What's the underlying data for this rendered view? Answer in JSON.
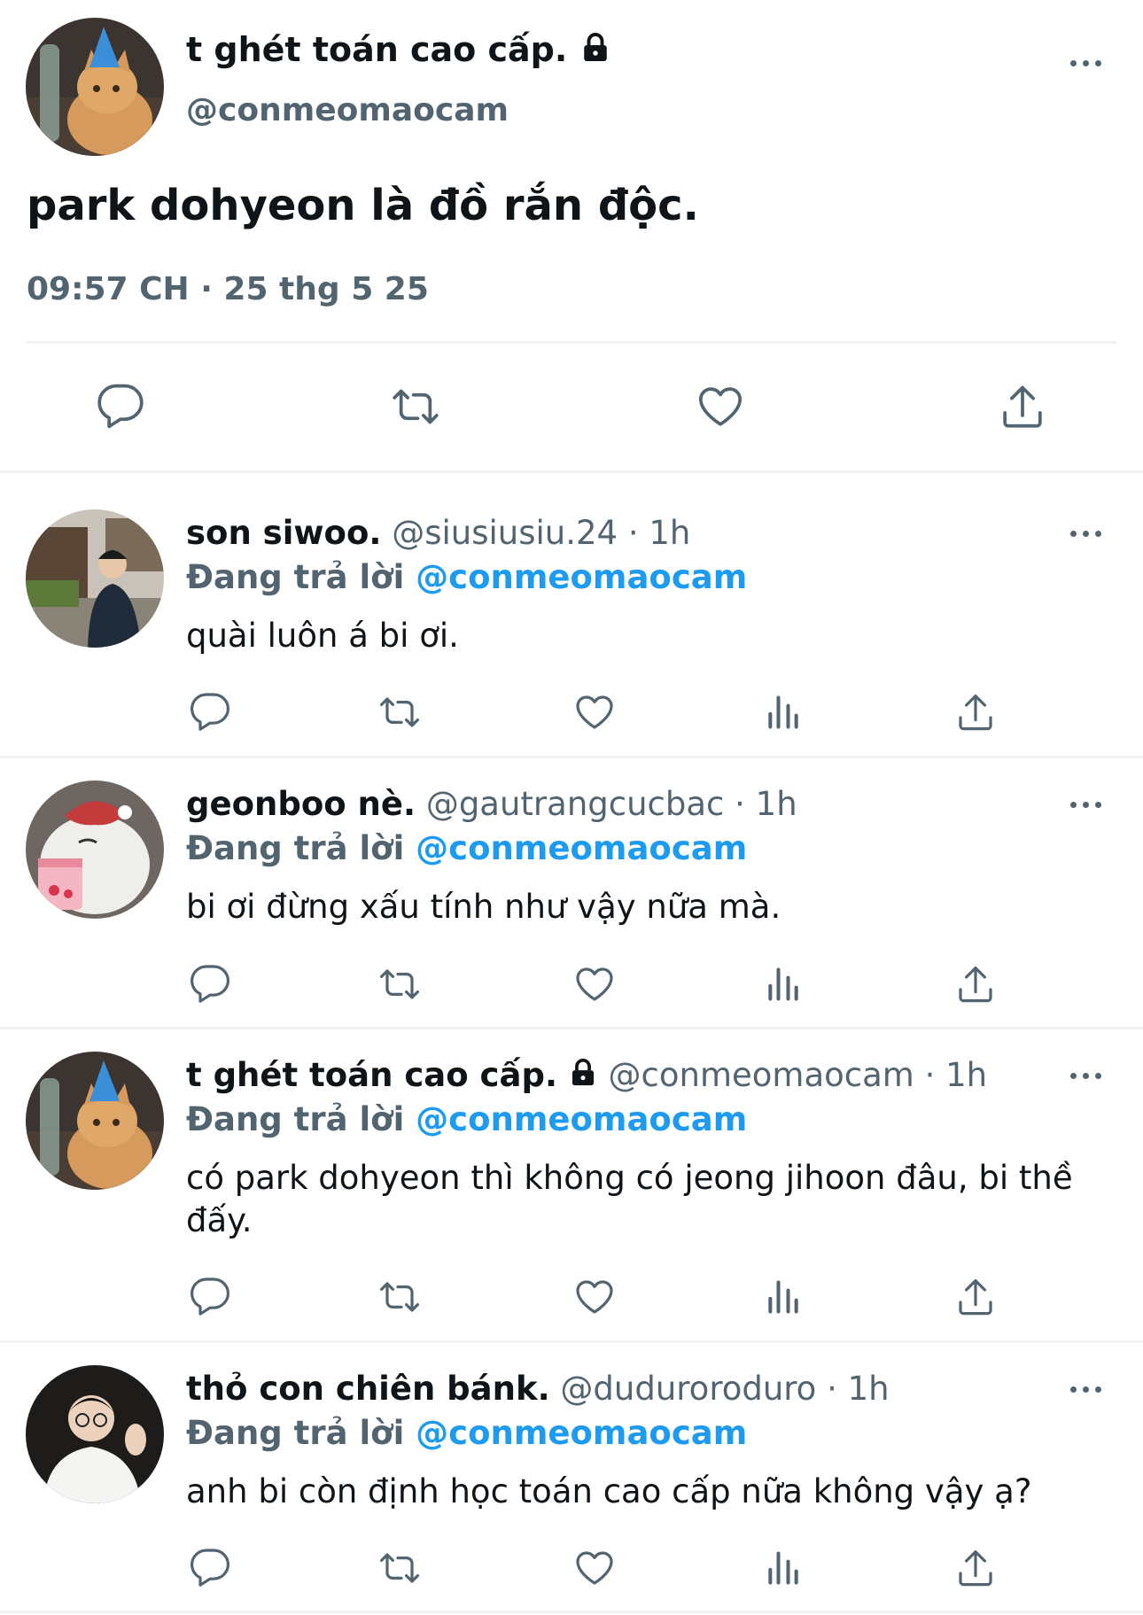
{
  "main_tweet": {
    "display_name": "t ghét toán cao cấp.",
    "handle": "@conmeomaocam",
    "text": "park dohyeon là đồ rắn độc.",
    "timestamp": "09:57 CH · 25 thg 5 25",
    "avatar": "orange-cat-with-party-hat"
  },
  "replies": [
    {
      "display_name": "son siwoo.",
      "handle": "@siusiusiu.24",
      "time": "· 1h",
      "replying_prefix": "Đang trả lời",
      "replying_to": "@conmeomaocam",
      "text": [
        "quài luôn á bi ơi."
      ],
      "avatar": "person-in-street",
      "locked": false
    },
    {
      "display_name": "geonboo nè.",
      "handle": "@gautrangcucbac",
      "time": "· 1h",
      "replying_prefix": "Đang trả lời",
      "replying_to": "@conmeomaocam",
      "text": [
        "bi ơi đừng xấu tính như vậy nữa mà."
      ],
      "avatar": "bear-with-strawberry-cup",
      "locked": false
    },
    {
      "display_name": "t ghét toán cao cấp.",
      "handle": "@conmeomaocam",
      "time": "· 1h",
      "replying_prefix": "Đang trả lời",
      "replying_to": "@conmeomaocam",
      "text": [
        "có park dohyeon thì không có jeong jihoon đâu, bi thề",
        "đấy."
      ],
      "avatar": "orange-cat-with-party-hat",
      "locked": true
    },
    {
      "display_name": "thỏ con chiên bánk.",
      "handle": "@duduroroduro",
      "time": "· 1h",
      "replying_prefix": "Đang trả lời",
      "replying_to": "@conmeomaocam",
      "text": [
        "anh bi còn định học toán cao cấp nữa không vậy ạ?"
      ],
      "avatar": "person-white-shirt-waving",
      "locked": false
    }
  ],
  "action_icons": [
    "reply-icon",
    "retweet-icon",
    "like-icon",
    "views-icon",
    "share-icon"
  ],
  "colors": {
    "text": "#0f1419",
    "muted": "#536471",
    "link": "#1d9bf0",
    "divider": "#eff3f4"
  }
}
